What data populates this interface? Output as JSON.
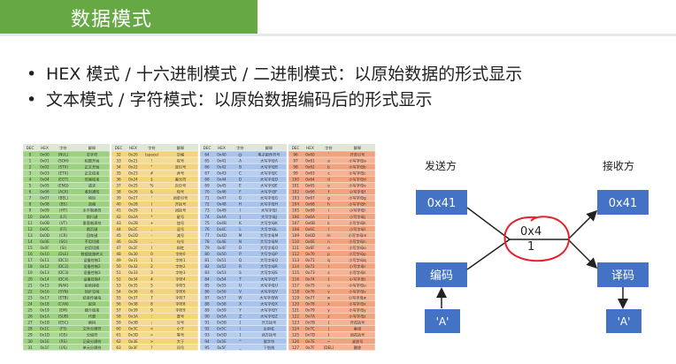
{
  "slide": {
    "title": "数据模式",
    "bullets": [
      "HEX 模式 / 十六进制模式 / 二进制模式：以原始数据的形式显示",
      "文本模式 / 字符模式：以原始数据编码后的形式显示"
    ]
  },
  "ascii_table": {
    "headers": [
      "DEC",
      "HEX",
      "字符",
      "解释"
    ],
    "columns": [
      {
        "color": "#9bd17f",
        "rows": [
          [
            "0",
            "0x00",
            "(NUL)",
            "空字符"
          ],
          [
            "1",
            "0x01",
            "(SOH)",
            "标题开始"
          ],
          [
            "2",
            "0x02",
            "(STX)",
            "正文开始"
          ],
          [
            "3",
            "0x03",
            "(ETX)",
            "正文结束"
          ],
          [
            "4",
            "0x04",
            "(EOT)",
            "传输结束"
          ],
          [
            "5",
            "0x05",
            "(ENQ)",
            "请求"
          ],
          [
            "6",
            "0x06",
            "(ACK)",
            "收到通知"
          ],
          [
            "7",
            "0x07",
            "(BEL)",
            "响铃"
          ],
          [
            "8",
            "0x08",
            "(BS)",
            "退格"
          ],
          [
            "9",
            "0x09",
            "(HT)",
            "水平制表符"
          ],
          [
            "10",
            "0x0A",
            "(LF)",
            "换行键"
          ],
          [
            "11",
            "0x0B",
            "(VT)",
            "垂直制表符"
          ],
          [
            "12",
            "0x0C",
            "(FF)",
            "换页键"
          ],
          [
            "13",
            "0x0D",
            "(CR)",
            "回车键"
          ],
          [
            "14",
            "0x0E",
            "(SO)",
            "不用切换"
          ],
          [
            "15",
            "0x0F",
            "(SI)",
            "启用切换"
          ],
          [
            "16",
            "0x10",
            "(DLE)",
            "数据链路转义"
          ],
          [
            "17",
            "0x11",
            "(DC1)",
            "设备控制1"
          ],
          [
            "18",
            "0x12",
            "(DC2)",
            "设备控制2"
          ],
          [
            "19",
            "0x13",
            "(DC3)",
            "设备控制3"
          ],
          [
            "20",
            "0x14",
            "(DC4)",
            "设备控制4"
          ],
          [
            "21",
            "0x15",
            "(NAK)",
            "拒绝接收"
          ],
          [
            "22",
            "0x16",
            "(SYN)",
            "同步空闲"
          ],
          [
            "23",
            "0x17",
            "(ETB)",
            "结束传输块"
          ],
          [
            "24",
            "0x18",
            "(CAN)",
            "取消"
          ],
          [
            "25",
            "0x19",
            "(EM)",
            "媒介结束"
          ],
          [
            "26",
            "0x1A",
            "(SUB)",
            "代替"
          ],
          [
            "27",
            "0x1B",
            "(ESC)",
            "换码"
          ],
          [
            "28",
            "0x1C",
            "(FS)",
            "文件分隔符"
          ],
          [
            "29",
            "0x1D",
            "(GS)",
            "分组符"
          ],
          [
            "30",
            "0x1E",
            "(RS)",
            "记录分隔符"
          ],
          [
            "31",
            "0x1F",
            "(US)",
            "单元分隔符"
          ]
        ]
      },
      {
        "color": "#f3d37c",
        "rows": [
          [
            "32",
            "0x20",
            "(space)",
            "空格"
          ],
          [
            "33",
            "0x21",
            "!",
            "叹号"
          ],
          [
            "34",
            "0x22",
            "\"",
            "双引号"
          ],
          [
            "35",
            "0x23",
            "#",
            "井号"
          ],
          [
            "36",
            "0x24",
            "$",
            "美元符"
          ],
          [
            "37",
            "0x25",
            "%",
            "百分号"
          ],
          [
            "38",
            "0x26",
            "&",
            "和号"
          ],
          [
            "39",
            "0x27",
            "'",
            "闭单引号"
          ],
          [
            "40",
            "0x28",
            "(",
            "开括号"
          ],
          [
            "41",
            "0x29",
            ")",
            "闭括号"
          ],
          [
            "42",
            "0x2A",
            "*",
            "星号"
          ],
          [
            "43",
            "0x2B",
            "+",
            "加号"
          ],
          [
            "44",
            "0x2C",
            ",",
            "逗号"
          ],
          [
            "45",
            "0x2D",
            "-",
            "减号"
          ],
          [
            "46",
            "0x2E",
            ".",
            "句号"
          ],
          [
            "47",
            "0x2F",
            "/",
            "斜杠"
          ],
          [
            "48",
            "0x30",
            "0",
            "字符0"
          ],
          [
            "49",
            "0x31",
            "1",
            "字符1"
          ],
          [
            "50",
            "0x32",
            "2",
            "字符2"
          ],
          [
            "51",
            "0x33",
            "3",
            "字符3"
          ],
          [
            "52",
            "0x34",
            "4",
            "字符4"
          ],
          [
            "53",
            "0x35",
            "5",
            "字符5"
          ],
          [
            "54",
            "0x36",
            "6",
            "字符6"
          ],
          [
            "55",
            "0x37",
            "7",
            "字符7"
          ],
          [
            "56",
            "0x38",
            "8",
            "字符8"
          ],
          [
            "57",
            "0x39",
            "9",
            "字符9"
          ],
          [
            "58",
            "0x3A",
            ":",
            "冒号"
          ],
          [
            "59",
            "0x3B",
            ";",
            "分号"
          ],
          [
            "60",
            "0x3C",
            "<",
            "小于"
          ],
          [
            "61",
            "0x3D",
            "=",
            "等号"
          ],
          [
            "62",
            "0x3E",
            ">",
            "大于"
          ],
          [
            "63",
            "0x3F",
            "?",
            "问号"
          ]
        ]
      },
      {
        "color": "#a9c4ec",
        "rows": [
          [
            "64",
            "0x40",
            "@",
            "电子邮件符号"
          ],
          [
            "65",
            "0x41",
            "A",
            "大写字母A"
          ],
          [
            "66",
            "0x42",
            "B",
            "大写字母B"
          ],
          [
            "67",
            "0x43",
            "C",
            "大写字母C"
          ],
          [
            "68",
            "0x44",
            "D",
            "大写字母D"
          ],
          [
            "69",
            "0x45",
            "E",
            "大写字母E"
          ],
          [
            "70",
            "0x46",
            "F",
            "大写字母F"
          ],
          [
            "71",
            "0x47",
            "G",
            "大写字母G"
          ],
          [
            "72",
            "0x48",
            "H",
            "大写字母H"
          ],
          [
            "73",
            "0x49",
            "I",
            "大写字母I"
          ],
          [
            "74",
            "0x4A",
            "J",
            "大写字母J"
          ],
          [
            "75",
            "0x4B",
            "K",
            "大写字母K"
          ],
          [
            "76",
            "0x4C",
            "L",
            "大写字母L"
          ],
          [
            "77",
            "0x4D",
            "M",
            "大写字母M"
          ],
          [
            "78",
            "0x4E",
            "N",
            "大写字母N"
          ],
          [
            "79",
            "0x4F",
            "O",
            "大写字母O"
          ],
          [
            "80",
            "0x50",
            "P",
            "大写字母P"
          ],
          [
            "81",
            "0x51",
            "Q",
            "大写字母Q"
          ],
          [
            "82",
            "0x52",
            "R",
            "大写字母R"
          ],
          [
            "83",
            "0x53",
            "S",
            "大写字母S"
          ],
          [
            "84",
            "0x54",
            "T",
            "大写字母T"
          ],
          [
            "85",
            "0x55",
            "U",
            "大写字母U"
          ],
          [
            "86",
            "0x56",
            "V",
            "大写字母V"
          ],
          [
            "87",
            "0x57",
            "W",
            "大写字母W"
          ],
          [
            "88",
            "0x58",
            "X",
            "大写字母X"
          ],
          [
            "89",
            "0x59",
            "Y",
            "大写字母Y"
          ],
          [
            "90",
            "0x5A",
            "Z",
            "大写字母Z"
          ],
          [
            "91",
            "0x5B",
            "[",
            "开方括号"
          ],
          [
            "92",
            "0x5C",
            "\\",
            "反斜杠"
          ],
          [
            "93",
            "0x5D",
            "]",
            "闭方括号"
          ],
          [
            "94",
            "0x5E",
            "^",
            "脱字符"
          ],
          [
            "95",
            "0x5F",
            "_",
            "下划线"
          ]
        ]
      },
      {
        "color": "#f1a37d",
        "rows": [
          [
            "96",
            "0x60",
            "`",
            "开单引号"
          ],
          [
            "97",
            "0x61",
            "a",
            "小写字母a"
          ],
          [
            "98",
            "0x62",
            "b",
            "小写字母b"
          ],
          [
            "99",
            "0x63",
            "c",
            "小写字母c"
          ],
          [
            "100",
            "0x64",
            "d",
            "小写字母d"
          ],
          [
            "101",
            "0x65",
            "e",
            "小写字母e"
          ],
          [
            "102",
            "0x66",
            "f",
            "小写字母f"
          ],
          [
            "103",
            "0x67",
            "g",
            "小写字母g"
          ],
          [
            "104",
            "0x68",
            "h",
            "小写字母h"
          ],
          [
            "105",
            "0x69",
            "i",
            "小写字母i"
          ],
          [
            "106",
            "0x6A",
            "j",
            "小写字母j"
          ],
          [
            "107",
            "0x6B",
            "k",
            "小写字母k"
          ],
          [
            "108",
            "0x6C",
            "l",
            "小写字母l"
          ],
          [
            "109",
            "0x6D",
            "m",
            "小写字母m"
          ],
          [
            "110",
            "0x6E",
            "n",
            "小写字母n"
          ],
          [
            "111",
            "0x6F",
            "o",
            "小写字母o"
          ],
          [
            "112",
            "0x70",
            "p",
            "小写字母p"
          ],
          [
            "113",
            "0x71",
            "q",
            "小写字母q"
          ],
          [
            "114",
            "0x72",
            "r",
            "小写字母r"
          ],
          [
            "115",
            "0x73",
            "s",
            "小写字母s"
          ],
          [
            "116",
            "0x74",
            "t",
            "小写字母t"
          ],
          [
            "117",
            "0x75",
            "u",
            "小写字母u"
          ],
          [
            "118",
            "0x76",
            "v",
            "小写字母v"
          ],
          [
            "119",
            "0x77",
            "w",
            "小写字母w"
          ],
          [
            "120",
            "0x78",
            "x",
            "小写字母x"
          ],
          [
            "121",
            "0x79",
            "y",
            "小写字母y"
          ],
          [
            "122",
            "0x7A",
            "z",
            "小写字母z"
          ],
          [
            "123",
            "0x7B",
            "{",
            "开花括号"
          ],
          [
            "124",
            "0x7C",
            "|",
            "垂线"
          ],
          [
            "125",
            "0x7D",
            "}",
            "闭花括号"
          ],
          [
            "126",
            "0x7E",
            "~",
            "波浪号"
          ],
          [
            "127",
            "0x7F",
            "(DEL)",
            "删除"
          ]
        ]
      }
    ]
  },
  "diagram": {
    "sender_label": "发送方",
    "receiver_label": "接收方",
    "sender_hex": "0x41",
    "receiver_hex": "0x41",
    "encode_label": "编码",
    "decode_label": "译码",
    "sender_char": "'A'",
    "receiver_char": "'A'",
    "wire_value_top": "0x4",
    "wire_value_bottom": "1",
    "box_color": "#4472c4",
    "highlight_color": "#e8202a"
  }
}
